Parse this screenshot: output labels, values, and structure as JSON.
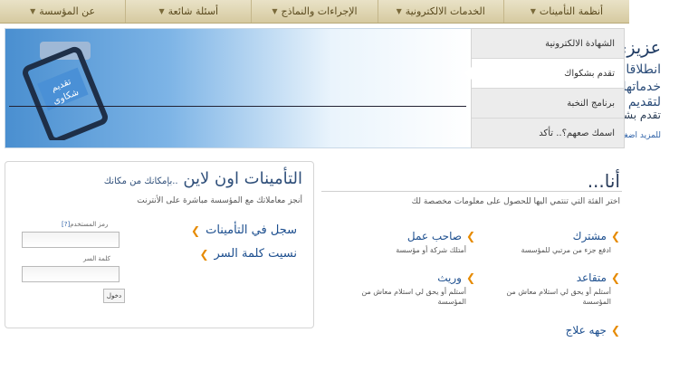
{
  "nav": {
    "items": [
      {
        "label": "أنظمة التأمينات"
      },
      {
        "label": "الخدمات الالكترونية"
      },
      {
        "label": "الإجراءات والنماذج"
      },
      {
        "label": "أسئلة شائعة"
      },
      {
        "label": "عن المؤسسة"
      }
    ]
  },
  "banner": {
    "title": "عزيزي العميل",
    "line1": "انطلاقا من حرص المؤسسة لتحسين",
    "line2": "خدماتها، تم إطلاق خدمة خاصة",
    "line3": "لتقديم الشكاوى",
    "subtitle": "تقدم بشكواك",
    "more_link": "للمزيد اضغط هنا",
    "clipboard_text": "تقديم شكاوى"
  },
  "side_menu": {
    "items": [
      {
        "label": "الشهادة الالكترونية"
      },
      {
        "label": "تقدم بشكواك"
      },
      {
        "label": "برنامج النخبة"
      },
      {
        "label": "اسمك صعهم؟.. تأكد"
      }
    ]
  },
  "login": {
    "title": "التأمينات اون لاين",
    "title_suffix": "..بإمكانك من مكانك",
    "description": "أنجز معاملاتك مع المؤسسة مباشرة على الأنترنت",
    "register_link": "سجل في التأمينات",
    "forgot_link": "نسيت كلمة السر",
    "username_label": "رمز المستخدم",
    "help_mark": "[?]",
    "password_label": "كلمة السر",
    "enter_button": "دخول"
  },
  "iam": {
    "title": "أنا...",
    "description": "اختر الفئة التي تنتمي اليها للحصول على معلومات مخصصة لك",
    "categories": [
      {
        "title": "مشترك",
        "desc": "ادفع جزء من مرتبي للمؤسسة"
      },
      {
        "title": "صاحب عمل",
        "desc": "أمتلك شركة أو مؤسسة"
      },
      {
        "title": "متقاعد",
        "desc": "أستلم أو يحق لي استلام معاش من المؤسسة"
      },
      {
        "title": "وريث",
        "desc": "أستلم أو يحق لي استلام معاش من المؤسسة"
      },
      {
        "title": "جهه علاج",
        "desc": ""
      }
    ]
  }
}
